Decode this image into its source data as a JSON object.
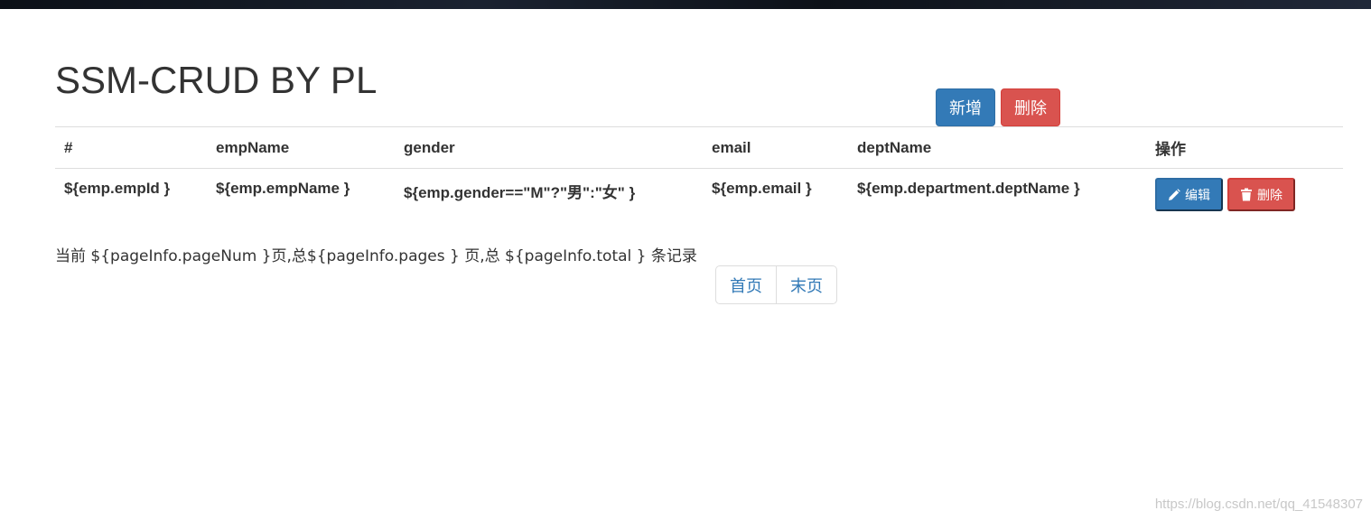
{
  "page": {
    "title": "SSM-CRUD BY PL",
    "watermark": "https://blog.csdn.net/qq_41548307"
  },
  "toolbar": {
    "add_label": "新增",
    "delete_label": "删除"
  },
  "table": {
    "headers": [
      "#",
      "empName",
      "gender",
      "email",
      "deptName",
      "操作"
    ],
    "rows": [
      {
        "id": "${emp.empId }",
        "name": "${emp.empName }",
        "gender": "${emp.gender==\"M\"?\"男\":\"女\" }",
        "email": "${emp.email }",
        "dept": "${emp.department.deptName }",
        "edit_label": "编辑",
        "delete_label": "删除",
        "edit_icon": "pencil-icon",
        "delete_icon": "trash-icon"
      }
    ]
  },
  "pager": {
    "summary": "当前 ${pageInfo.pageNum }页,总${pageInfo.pages } 页,总 ${pageInfo.total } 条记录",
    "first_label": "首页",
    "last_label": "末页"
  },
  "colors": {
    "primary": "#337ab7",
    "danger": "#d9534f",
    "link": "#337ab7"
  }
}
